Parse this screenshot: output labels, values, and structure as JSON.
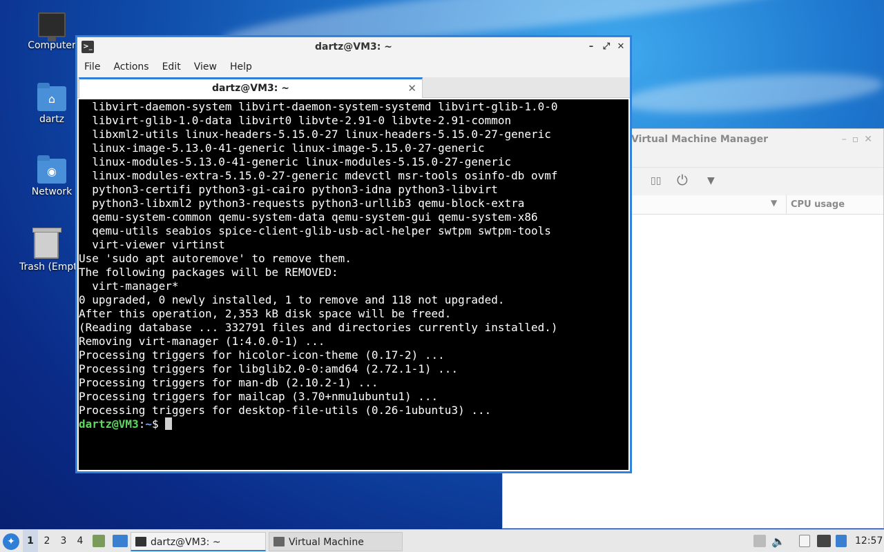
{
  "desktop": {
    "icons": [
      {
        "label": "Computer"
      },
      {
        "label": "dartz"
      },
      {
        "label": "Network"
      },
      {
        "label": "Trash (Empty)"
      }
    ]
  },
  "vmm": {
    "title": "Virtual Machine Manager",
    "columns": {
      "cpu": "CPU usage"
    }
  },
  "terminal": {
    "title": "dartz@VM3: ~",
    "menu": [
      "File",
      "Actions",
      "Edit",
      "View",
      "Help"
    ],
    "tab_label": "dartz@VM3: ~",
    "lines": [
      "  libvirt-daemon-system libvirt-daemon-system-systemd libvirt-glib-1.0-0",
      "  libvirt-glib-1.0-data libvirt0 libvte-2.91-0 libvte-2.91-common",
      "  libxml2-utils linux-headers-5.15.0-27 linux-headers-5.15.0-27-generic",
      "  linux-image-5.13.0-41-generic linux-image-5.15.0-27-generic",
      "  linux-modules-5.13.0-41-generic linux-modules-5.15.0-27-generic",
      "  linux-modules-extra-5.15.0-27-generic mdevctl msr-tools osinfo-db ovmf",
      "  python3-certifi python3-gi-cairo python3-idna python3-libvirt",
      "  python3-libxml2 python3-requests python3-urllib3 qemu-block-extra",
      "  qemu-system-common qemu-system-data qemu-system-gui qemu-system-x86",
      "  qemu-utils seabios spice-client-glib-usb-acl-helper swtpm swtpm-tools",
      "  virt-viewer virtinst",
      "Use 'sudo apt autoremove' to remove them.",
      "The following packages will be REMOVED:",
      "  virt-manager*",
      "0 upgraded, 0 newly installed, 1 to remove and 118 not upgraded.",
      "After this operation, 2,353 kB disk space will be freed.",
      "(Reading database ... 332791 files and directories currently installed.)",
      "Removing virt-manager (1:4.0.0-1) ...",
      "Processing triggers for hicolor-icon-theme (0.17-2) ...",
      "Processing triggers for libglib2.0-0:amd64 (2.72.1-1) ...",
      "Processing triggers for man-db (2.10.2-1) ...",
      "Processing triggers for mailcap (3.70+nmu1ubuntu1) ...",
      "Processing triggers for desktop-file-utils (0.26-1ubuntu3) ..."
    ],
    "prompt_user": "dartz@VM3",
    "prompt_sep": ":",
    "prompt_path": "~",
    "prompt_end": "$ "
  },
  "taskbar": {
    "workspaces": [
      "1",
      "2",
      "3",
      "4"
    ],
    "windows": [
      {
        "label": "dartz@VM3: ~"
      },
      {
        "label": "Virtual Machine Mana..."
      }
    ],
    "clock": "12:57"
  }
}
